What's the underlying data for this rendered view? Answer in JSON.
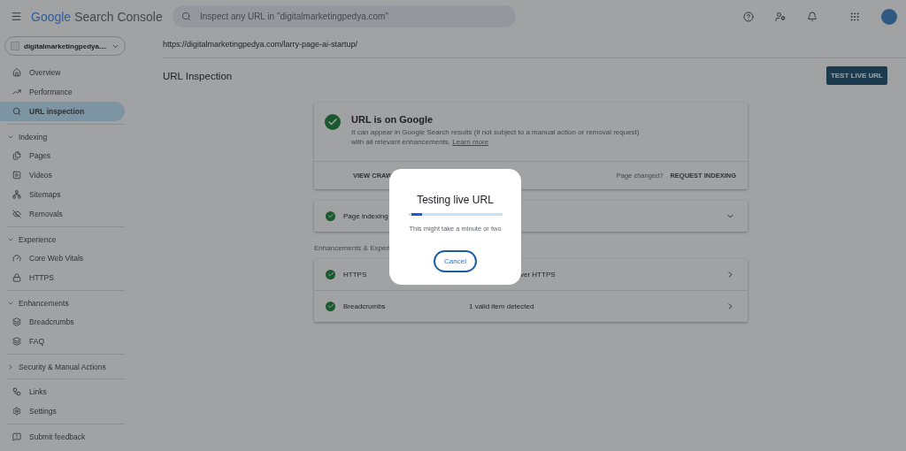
{
  "header": {
    "product": "Search Console",
    "logo": "Google",
    "search": {
      "placeholder": "Inspect any URL in \"digitalmarketingpedya.com\""
    }
  },
  "sidebar": {
    "property": "digitalmarketingpedya....",
    "groups": [
      {
        "kind": "group",
        "items": [
          {
            "label": "Overview",
            "selected": false
          },
          {
            "label": "Performance",
            "selected": false
          },
          {
            "label": "URL inspection",
            "selected": true
          }
        ]
      },
      {
        "kind": "section",
        "label": "Indexing",
        "expanded": true,
        "items": [
          {
            "label": "Pages",
            "selected": false
          },
          {
            "label": "Videos",
            "selected": false
          },
          {
            "label": "Sitemaps",
            "selected": false
          },
          {
            "label": "Removals",
            "selected": false
          }
        ]
      },
      {
        "kind": "section",
        "label": "Experience",
        "expanded": true,
        "items": [
          {
            "label": "Core Web Vitals",
            "selected": false
          },
          {
            "label": "HTTPS",
            "selected": false
          }
        ]
      },
      {
        "kind": "section",
        "label": "Enhancements",
        "expanded": true,
        "items": [
          {
            "label": "Breadcrumbs",
            "selected": false
          },
          {
            "label": "FAQ",
            "selected": false
          }
        ]
      },
      {
        "kind": "section",
        "label": "Security & Manual Actions",
        "expanded": false
      },
      {
        "kind": "group",
        "items": [
          {
            "label": "Links",
            "selected": false
          },
          {
            "label": "Settings",
            "selected": false
          }
        ]
      },
      {
        "kind": "group",
        "items": [
          {
            "label": "Submit feedback",
            "selected": false
          }
        ]
      }
    ]
  },
  "main": {
    "url": "https://digitalmarketingpedya.com/larry-page-ai-startup/",
    "title": "URL Inspection",
    "test_button": "TEST LIVE URL",
    "status_card": {
      "title": "URL is on Google",
      "description": "It can appear in Google Search results (if not subject to a manual action or removal request) with all relevant enhancements.",
      "link": "Learn more",
      "action_left": "VIEW CRAW",
      "page_changed": "Page changed?",
      "action_right": "REQUEST INDEXING"
    },
    "indexing_row": {
      "label": "Page indexing"
    },
    "enhancements_heading": "Enhancements & Experi",
    "enhancements": [
      {
        "label": "HTTPS",
        "status": "ver HTTPS"
      },
      {
        "label": "Breadcrumbs",
        "status": "1 valid item detected"
      }
    ]
  },
  "dialog": {
    "title": "Testing live URL",
    "level": 0.12,
    "message": "This might take a minute or two",
    "button": "Cancel"
  }
}
